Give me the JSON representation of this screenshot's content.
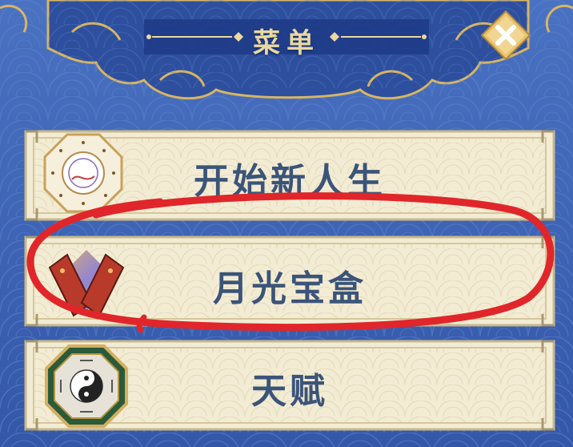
{
  "menu": {
    "title": "菜单",
    "close_icon": "close-x-icon",
    "items": [
      {
        "label": "开始新人生",
        "icon": "compass-calendar-icon"
      },
      {
        "label": "月光宝盒",
        "icon": "moonlight-box-icon"
      },
      {
        "label": "天赋",
        "icon": "bagua-talent-icon"
      }
    ]
  },
  "annotation": {
    "color": "#e0262a"
  },
  "colors": {
    "background": "#3a63b6",
    "title_bar": "#1f3a86",
    "panel": "#f3ecd4",
    "label": "#3b5479",
    "gold": "#d9b562"
  }
}
